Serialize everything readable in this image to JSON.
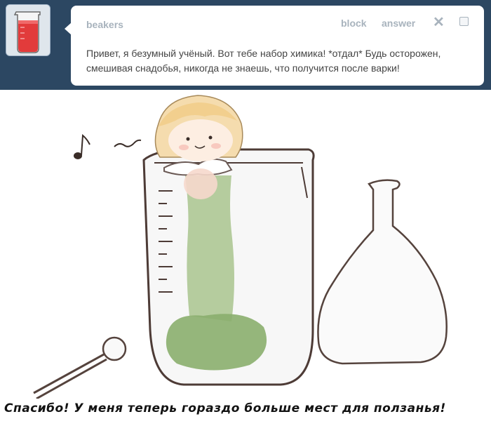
{
  "ask": {
    "asker_name": "beakers",
    "block_label": "block",
    "answer_label": "answer",
    "close_icon": "close-icon",
    "question_text": "Привет, я безумный учёный. Вот тебе набор химика! *отдал* Будь осторожен, смешивая снадобья, никогда не знаешь, что получится после варки!"
  },
  "comic": {
    "caption": "Спасибо! У меня теперь гораздо больше мест для ползанья!"
  },
  "colors": {
    "header_bg": "#2c4762",
    "liquid_red": "#e23b3b",
    "moss_green": "#6f9a55"
  }
}
